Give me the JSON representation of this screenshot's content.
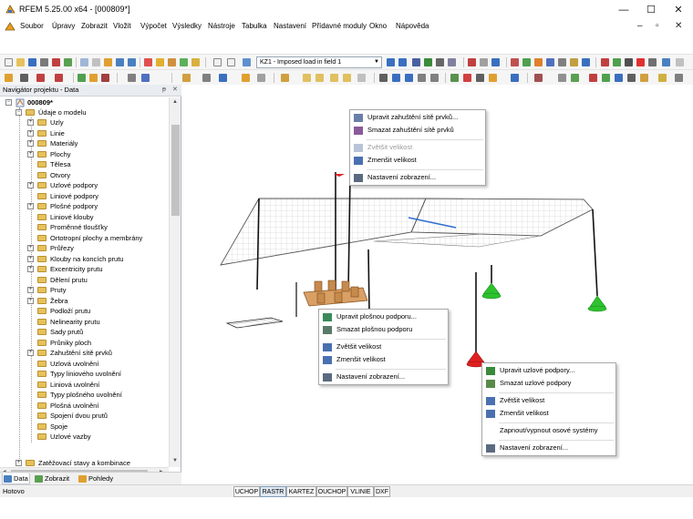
{
  "window": {
    "title": "RFEM 5.25.00 x64 - [000809*]",
    "controls": [
      "—",
      "☐",
      "✕"
    ],
    "mdi_controls": [
      "–",
      "▫",
      "✕"
    ]
  },
  "menu": [
    "Soubor",
    "Úpravy",
    "Zobrazit",
    "Vložit",
    "Výpočet",
    "Výsledky",
    "Nástroje",
    "Tabulka",
    "Nastavení",
    "Přídavné moduly",
    "Okno",
    "Nápověda"
  ],
  "toolbar": {
    "load_case": "KZ1 - Imposed load in field 1",
    "dropdown_icon": "chevron-down-icon"
  },
  "navigator": {
    "title": "Navigátor projektu - Data",
    "header_buttons": [
      "ᵽ",
      "✕"
    ],
    "root": "000809*",
    "group1": "Údaje o modelu",
    "items": [
      "Uzly",
      "Linie",
      "Materiály",
      "Plochy",
      "Tělesa",
      "Otvory",
      "Uzlové podpory",
      "Liniové podpory",
      "Plošné podpory",
      "Liniové klouby",
      "Proměnné tloušťky",
      "Ortotropní plochy a membrány",
      "Průřezy",
      "Klouby na koncích prutu",
      "Excentricity prutu",
      "Dělení prutu",
      "Pruty",
      "Žebra",
      "Podloží prutu",
      "Nelinearity prutu",
      "Sady prutů",
      "Průniky ploch",
      "Zahuštění sítě prvků",
      "Uzlová uvolnění",
      "Typy liniového uvolnění",
      "Liniová uvolnění",
      "Typy plošného uvolnění",
      "Plošná uvolnění",
      "Spojení dvou prutů",
      "Spoje",
      "Uzlové vazby"
    ],
    "group2": "Zatěžovací stavy a kombinace",
    "tabs": [
      "Data",
      "Zobrazit",
      "Pohledy"
    ]
  },
  "context_menus": {
    "mesh": [
      "Upravit zahuštění sítě prvků...",
      "Smazat zahuštění sítě prvků",
      "Zvětšit velikost",
      "Zmenšit velikost",
      "Nastavení zobrazení..."
    ],
    "surface_support": [
      "Upravit plošnou podporu...",
      "Smazat plošnou podporu",
      "Zvětšit velikost",
      "Zmenšit velikost",
      "Nastavení zobrazení..."
    ],
    "nodal_support": [
      "Upravit uzlové podpory...",
      "Smazat uzlové podpory",
      "Zvětšit velikost",
      "Zmenšit velikost",
      "Zapnout/vypnout osové systémy",
      "Nastavení zobrazení..."
    ]
  },
  "status": {
    "text": "Hotovo",
    "toggles": [
      "UCHOP",
      "RASTR",
      "KARTEZ",
      "OUCHOP",
      "VLINIE",
      "DXF"
    ]
  },
  "colors": {
    "accent": "#1e6fc7",
    "support_green": "#2ec22e",
    "support_red": "#e02020",
    "folder": "#e6c15c"
  }
}
